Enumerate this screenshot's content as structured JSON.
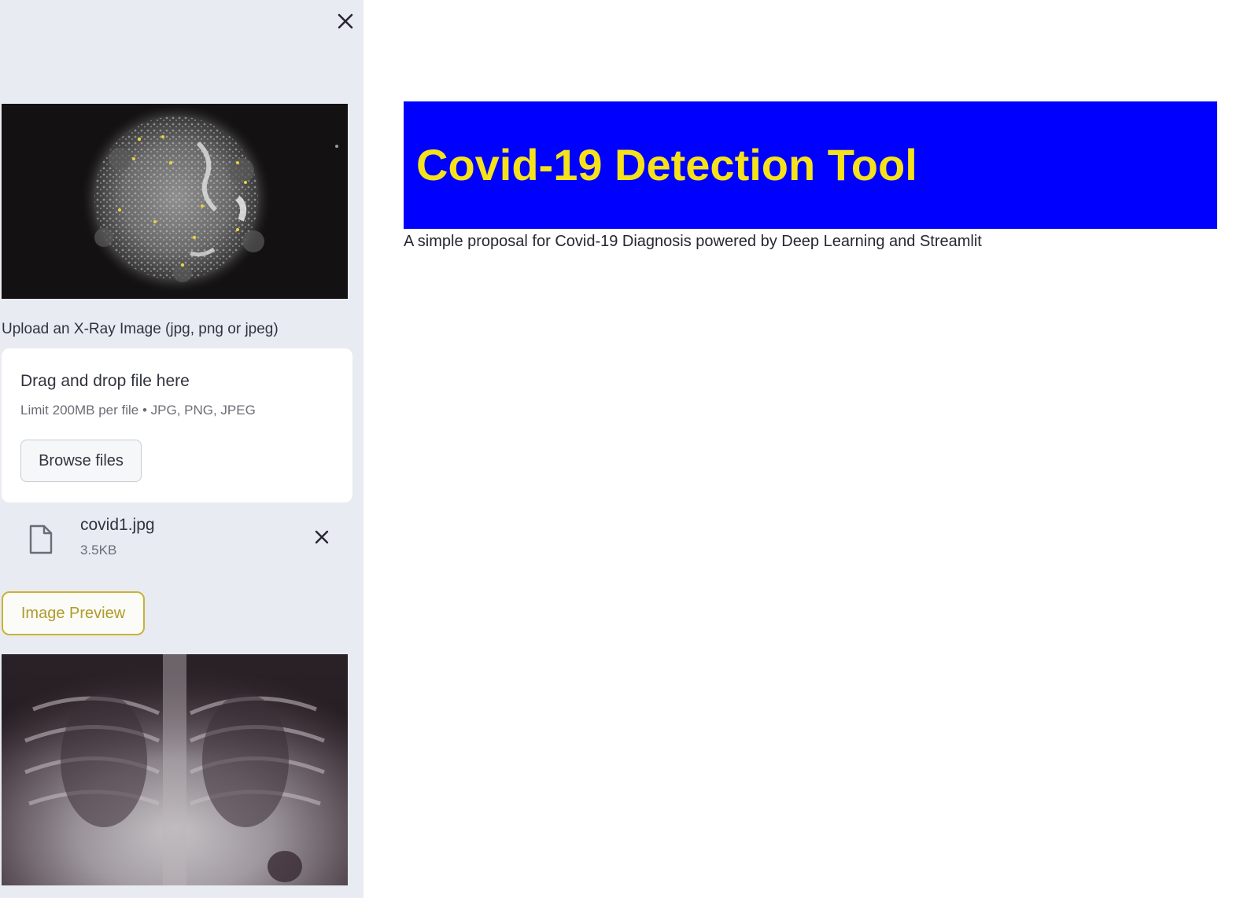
{
  "sidebar": {
    "hero_image_icon": "virus-image",
    "upload": {
      "label": "Upload an X-Ray Image (jpg, png or jpeg)",
      "drop_title": "Drag and drop file here",
      "drop_subtitle": "Limit 200MB per file • JPG, PNG, JPEG",
      "browse_label": "Browse files"
    },
    "uploaded_file": {
      "name": "covid1.jpg",
      "size": "3.5KB",
      "icon": "file-icon"
    },
    "preview_button_label": "Image Preview",
    "preview_image_icon": "chest-xray-image"
  },
  "main": {
    "title": "Covid-19 Detection Tool",
    "subtitle": "A simple proposal for Covid-19 Diagnosis powered by Deep Learning and Streamlit"
  },
  "colors": {
    "banner_bg": "#0000ff",
    "title_text": "#f5e21b",
    "sidebar_bg": "#e8ebf2",
    "preview_button_accent": "#c8b23a"
  }
}
